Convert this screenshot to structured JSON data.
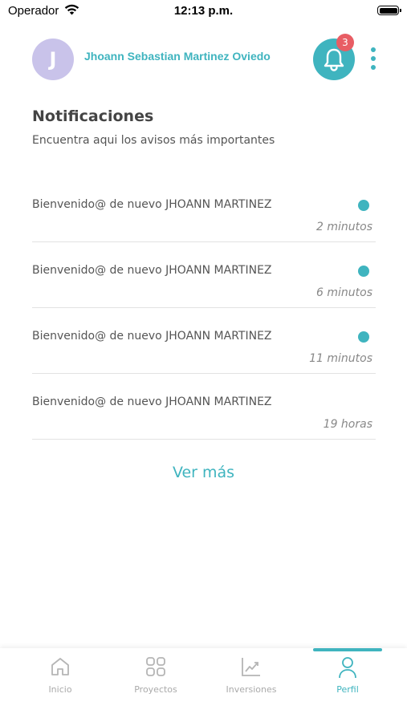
{
  "status_bar": {
    "carrier": "Operador",
    "time": "12:13 p.m."
  },
  "header": {
    "avatar_initial": "J",
    "user_name": "Jhoann Sebastian Martinez Oviedo",
    "notification_count": "3"
  },
  "notifications": {
    "title": "Notificaciones",
    "subtitle": "Encuentra aqui los avisos más importantes",
    "items": [
      {
        "text": "Bienvenido@ de nuevo JHOANN MARTINEZ",
        "time": "2 minutos",
        "unread": true
      },
      {
        "text": "Bienvenido@ de nuevo JHOANN MARTINEZ",
        "time": "6 minutos",
        "unread": true
      },
      {
        "text": "Bienvenido@ de nuevo JHOANN MARTINEZ",
        "time": "11 minutos",
        "unread": true
      },
      {
        "text": "Bienvenido@ de nuevo JHOANN MARTINEZ",
        "time": "19 horas",
        "unread": false
      }
    ],
    "see_more": "Ver más"
  },
  "tab_bar": {
    "tabs": [
      {
        "label": "Inicio",
        "icon": "home-icon",
        "active": false
      },
      {
        "label": "Proyectos",
        "icon": "grid-icon",
        "active": false
      },
      {
        "label": "Inversiones",
        "icon": "chart-icon",
        "active": false
      },
      {
        "label": "Perfil",
        "icon": "user-icon",
        "active": true
      }
    ]
  },
  "colors": {
    "accent": "#3fb4bf",
    "badge": "#e85d64",
    "avatar": "#c9c3ea"
  }
}
